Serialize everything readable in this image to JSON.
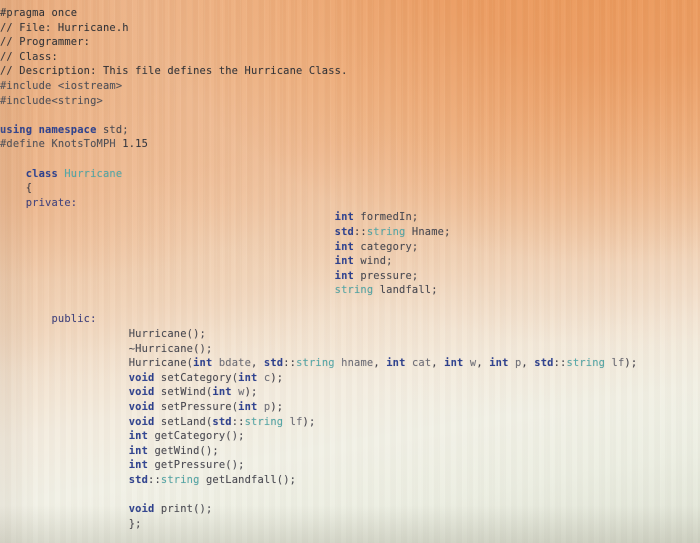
{
  "window": {
    "title": "Hurricane.h",
    "description": "Photograph of a screen showing C++ header source code for a Hurricane class"
  },
  "colors": {
    "background_top_left": "#e9a06c",
    "background_top_right": "#e8995a",
    "background_bottom_left": "#f2f0e8",
    "background_bottom_right": "#dcdcd0",
    "keyword": "#2b3f8f",
    "type": "#4fa8a8",
    "comment": "#2e2f33",
    "identifier": "#44454e",
    "preprocessor": "#4c4d55"
  },
  "code": {
    "language": "cpp",
    "file_name": "Hurricane.h",
    "lines": [
      {
        "indent": 0,
        "tokens": [
          {
            "t": "#pragma once",
            "c": "cmt"
          }
        ]
      },
      {
        "indent": 0,
        "tokens": [
          {
            "t": "// File: Hurricane.h",
            "c": "cmt"
          }
        ]
      },
      {
        "indent": 0,
        "tokens": [
          {
            "t": "// Programmer:",
            "c": "cmt"
          }
        ]
      },
      {
        "indent": 0,
        "tokens": [
          {
            "t": "// Class:",
            "c": "cmt"
          }
        ]
      },
      {
        "indent": 0,
        "tokens": [
          {
            "t": "// Description: This file defines the Hurricane Class.",
            "c": "cmt"
          }
        ]
      },
      {
        "indent": 0,
        "tokens": [
          {
            "t": "#include <iostream>",
            "c": "pre"
          }
        ]
      },
      {
        "indent": 0,
        "tokens": [
          {
            "t": "#include<string>",
            "c": "pre"
          }
        ]
      },
      {
        "indent": 0,
        "tokens": []
      },
      {
        "indent": 0,
        "tokens": [
          {
            "t": "using",
            "c": "kw"
          },
          {
            "t": " ",
            "c": "pun"
          },
          {
            "t": "namespace",
            "c": "kw"
          },
          {
            "t": " std;",
            "c": "id"
          }
        ]
      },
      {
        "indent": 0,
        "tokens": [
          {
            "t": "#define KnotsToMPH ",
            "c": "pre"
          },
          {
            "t": "1.15",
            "c": "num"
          }
        ]
      },
      {
        "indent": 0,
        "tokens": []
      },
      {
        "indent": 1,
        "tokens": [
          {
            "t": "class",
            "c": "kw"
          },
          {
            "t": " ",
            "c": "pun"
          },
          {
            "t": "Hurricane",
            "c": "typ"
          }
        ]
      },
      {
        "indent": 1,
        "tokens": [
          {
            "t": "{",
            "c": "pun"
          }
        ]
      },
      {
        "indent": 1,
        "tokens": [
          {
            "t": "private:",
            "c": "kw2"
          }
        ]
      },
      {
        "indent": 13,
        "tokens": [
          {
            "t": "int",
            "c": "kw"
          },
          {
            "t": " formedIn;",
            "c": "id"
          }
        ]
      },
      {
        "indent": 13,
        "tokens": [
          {
            "t": "std",
            "c": "kw"
          },
          {
            "t": "::",
            "c": "pun"
          },
          {
            "t": "string",
            "c": "typ"
          },
          {
            "t": " Hname;",
            "c": "id"
          }
        ]
      },
      {
        "indent": 13,
        "tokens": [
          {
            "t": "int",
            "c": "kw"
          },
          {
            "t": " category;",
            "c": "id"
          }
        ]
      },
      {
        "indent": 13,
        "tokens": [
          {
            "t": "int",
            "c": "kw"
          },
          {
            "t": " wind;",
            "c": "id"
          }
        ]
      },
      {
        "indent": 13,
        "tokens": [
          {
            "t": "int",
            "c": "kw"
          },
          {
            "t": " pressure;",
            "c": "id"
          }
        ]
      },
      {
        "indent": 13,
        "tokens": [
          {
            "t": "string",
            "c": "typ"
          },
          {
            "t": " landfall;",
            "c": "id"
          }
        ]
      },
      {
        "indent": 0,
        "tokens": []
      },
      {
        "indent": 2,
        "tokens": [
          {
            "t": "public:",
            "c": "kw2"
          }
        ]
      },
      {
        "indent": 5,
        "tokens": [
          {
            "t": "Hurricane();",
            "c": "id"
          }
        ]
      },
      {
        "indent": 5,
        "tokens": [
          {
            "t": "~Hurricane();",
            "c": "id"
          }
        ]
      },
      {
        "indent": 5,
        "tokens": [
          {
            "t": "Hurricane(",
            "c": "id"
          },
          {
            "t": "int",
            "c": "kw"
          },
          {
            "t": " ",
            "c": "pun"
          },
          {
            "t": "bdate",
            "c": "idl"
          },
          {
            "t": ", ",
            "c": "pun"
          },
          {
            "t": "std",
            "c": "kw"
          },
          {
            "t": "::",
            "c": "pun"
          },
          {
            "t": "string",
            "c": "typ"
          },
          {
            "t": " ",
            "c": "pun"
          },
          {
            "t": "hname",
            "c": "idl"
          },
          {
            "t": ", ",
            "c": "pun"
          },
          {
            "t": "int",
            "c": "kw"
          },
          {
            "t": " ",
            "c": "pun"
          },
          {
            "t": "cat",
            "c": "idl"
          },
          {
            "t": ", ",
            "c": "pun"
          },
          {
            "t": "int",
            "c": "kw"
          },
          {
            "t": " ",
            "c": "pun"
          },
          {
            "t": "w",
            "c": "idl"
          },
          {
            "t": ", ",
            "c": "pun"
          },
          {
            "t": "int",
            "c": "kw"
          },
          {
            "t": " ",
            "c": "pun"
          },
          {
            "t": "p",
            "c": "idl"
          },
          {
            "t": ", ",
            "c": "pun"
          },
          {
            "t": "std",
            "c": "kw"
          },
          {
            "t": "::",
            "c": "pun"
          },
          {
            "t": "string",
            "c": "typ"
          },
          {
            "t": " ",
            "c": "pun"
          },
          {
            "t": "lf",
            "c": "idl"
          },
          {
            "t": ");",
            "c": "pun"
          }
        ]
      },
      {
        "indent": 5,
        "tokens": [
          {
            "t": "void",
            "c": "kw"
          },
          {
            "t": " setCategory(",
            "c": "id"
          },
          {
            "t": "int",
            "c": "kw"
          },
          {
            "t": " ",
            "c": "pun"
          },
          {
            "t": "c",
            "c": "idl"
          },
          {
            "t": ");",
            "c": "pun"
          }
        ]
      },
      {
        "indent": 5,
        "tokens": [
          {
            "t": "void",
            "c": "kw"
          },
          {
            "t": " setWind(",
            "c": "id"
          },
          {
            "t": "int",
            "c": "kw"
          },
          {
            "t": " ",
            "c": "pun"
          },
          {
            "t": "w",
            "c": "idl"
          },
          {
            "t": ");",
            "c": "pun"
          }
        ]
      },
      {
        "indent": 5,
        "tokens": [
          {
            "t": "void",
            "c": "kw"
          },
          {
            "t": " setPressure(",
            "c": "id"
          },
          {
            "t": "int",
            "c": "kw"
          },
          {
            "t": " ",
            "c": "pun"
          },
          {
            "t": "p",
            "c": "idl"
          },
          {
            "t": ");",
            "c": "pun"
          }
        ]
      },
      {
        "indent": 5,
        "tokens": [
          {
            "t": "void",
            "c": "kw"
          },
          {
            "t": " setLand(",
            "c": "id"
          },
          {
            "t": "std",
            "c": "kw"
          },
          {
            "t": "::",
            "c": "pun"
          },
          {
            "t": "string",
            "c": "typ"
          },
          {
            "t": " ",
            "c": "pun"
          },
          {
            "t": "lf",
            "c": "idl"
          },
          {
            "t": ");",
            "c": "pun"
          }
        ]
      },
      {
        "indent": 5,
        "tokens": [
          {
            "t": "int",
            "c": "kw"
          },
          {
            "t": " getCategory();",
            "c": "id"
          }
        ]
      },
      {
        "indent": 5,
        "tokens": [
          {
            "t": "int",
            "c": "kw"
          },
          {
            "t": " getWind();",
            "c": "id"
          }
        ]
      },
      {
        "indent": 5,
        "tokens": [
          {
            "t": "int",
            "c": "kw"
          },
          {
            "t": " getPressure();",
            "c": "id"
          }
        ]
      },
      {
        "indent": 5,
        "tokens": [
          {
            "t": "std",
            "c": "kw"
          },
          {
            "t": "::",
            "c": "pun"
          },
          {
            "t": "string",
            "c": "typ"
          },
          {
            "t": " getLandfall();",
            "c": "id"
          }
        ]
      },
      {
        "indent": 0,
        "tokens": []
      },
      {
        "indent": 5,
        "tokens": [
          {
            "t": "void",
            "c": "kw"
          },
          {
            "t": " print();",
            "c": "id"
          }
        ]
      },
      {
        "indent": 5,
        "tokens": [
          {
            "t": "};",
            "c": "pun"
          }
        ]
      }
    ]
  }
}
